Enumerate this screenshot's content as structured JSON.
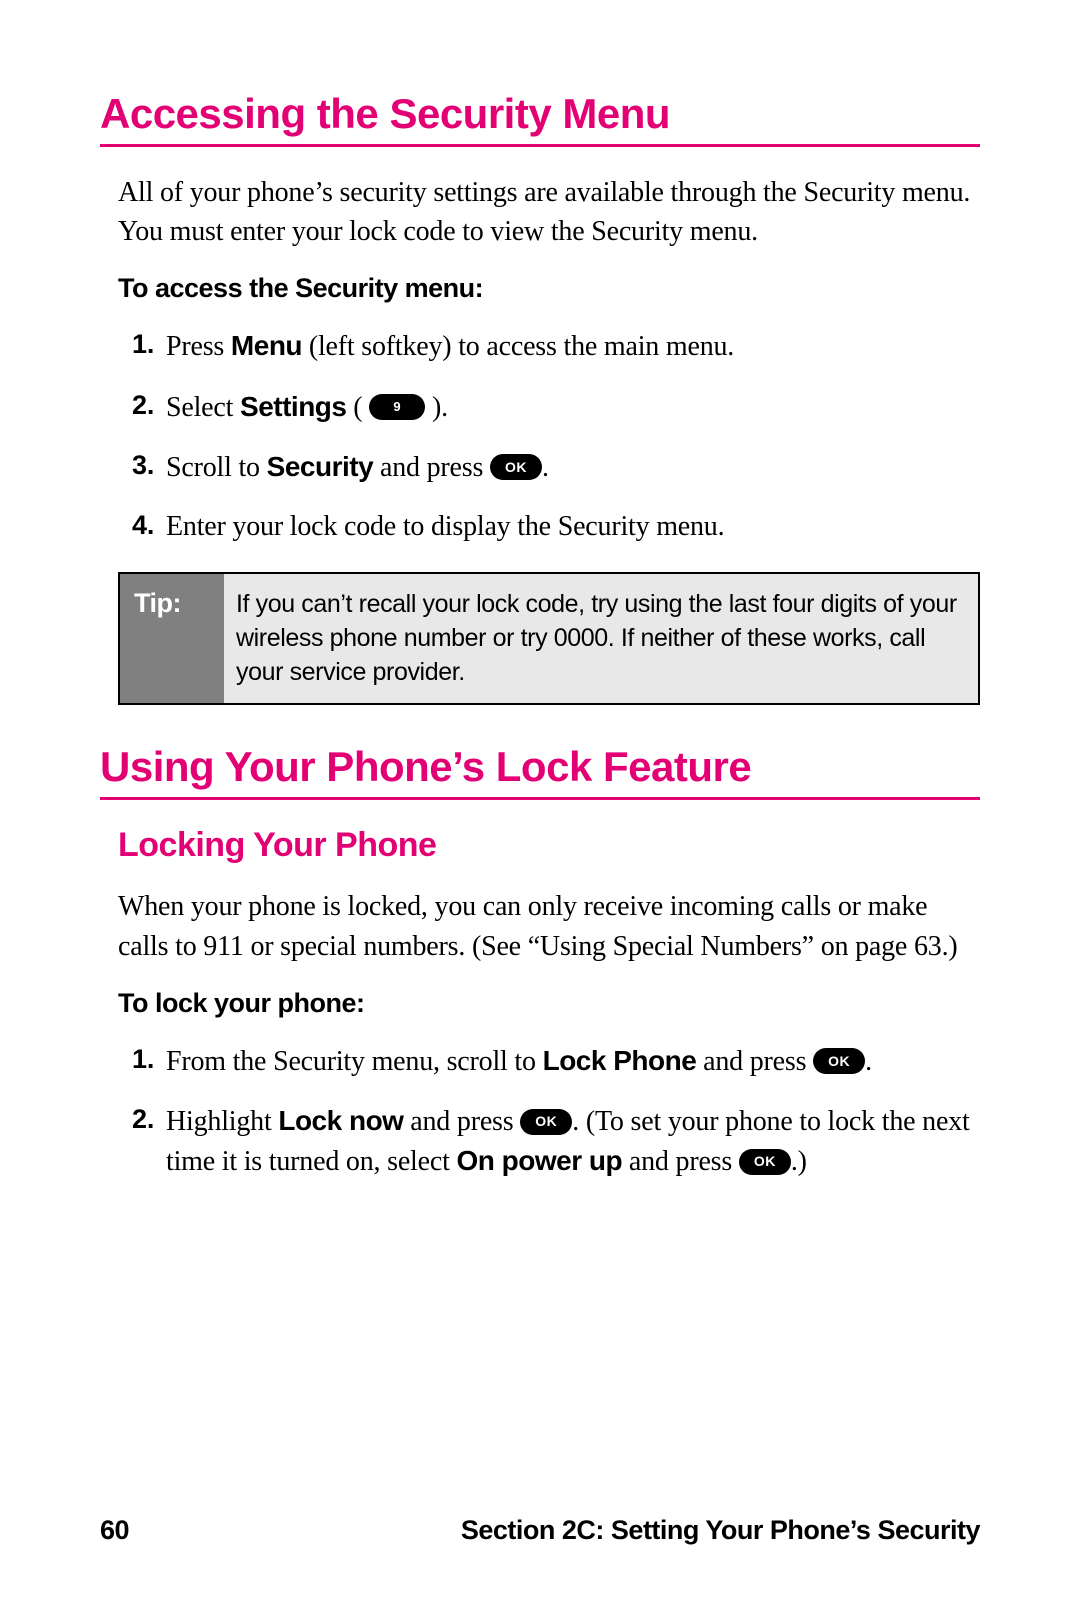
{
  "section1": {
    "title": "Accessing the Security Menu",
    "intro": "All of your phone’s security settings are available through the Security menu. You must enter your lock code to view the Security menu.",
    "stepHead": "To access the Security menu:",
    "steps": {
      "s1": {
        "num": "1.",
        "pre": "Press ",
        "bold": "Menu",
        "post": " (left softkey) to access the main menu."
      },
      "s2": {
        "num": "2.",
        "pre": "Select ",
        "bold": "Settings",
        "open": " ( ",
        "key": "9",
        "close": " )."
      },
      "s3": {
        "num": "3.",
        "pre": "Scroll to ",
        "bold": "Security",
        "mid": " and press ",
        "key": "OK",
        "post": "."
      },
      "s4": {
        "num": "4.",
        "text": "Enter your lock code to display the Security menu."
      }
    },
    "tip": {
      "label": "Tip:",
      "body": "If you can’t recall your lock code, try using the last four digits of your wireless phone number or try 0000. If neither of these works, call your service provider."
    }
  },
  "section2": {
    "title": "Using Your Phone’s Lock Feature",
    "sub": "Locking Your Phone",
    "intro": "When your phone is locked, you can only receive incoming calls or make calls to 911 or special numbers. (See “Using Special Numbers” on page 63.)",
    "stepHead": "To lock your phone:",
    "steps": {
      "s1": {
        "num": "1.",
        "pre": "From the Security menu, scroll to ",
        "bold": "Lock Phone",
        "mid": " and press ",
        "key": "OK",
        "post": "."
      },
      "s2": {
        "num": "2.",
        "pre": "Highlight ",
        "bold1": "Lock now",
        "mid1": " and press ",
        "key1": "OK",
        "mid2": ". (To set your phone to lock the next time it is turned on, select ",
        "bold2": "On power up",
        "mid3": " and press ",
        "key2": "OK",
        "post": ".)"
      }
    }
  },
  "footer": {
    "page": "60",
    "section": "Section 2C: Setting Your Phone’s Security"
  }
}
